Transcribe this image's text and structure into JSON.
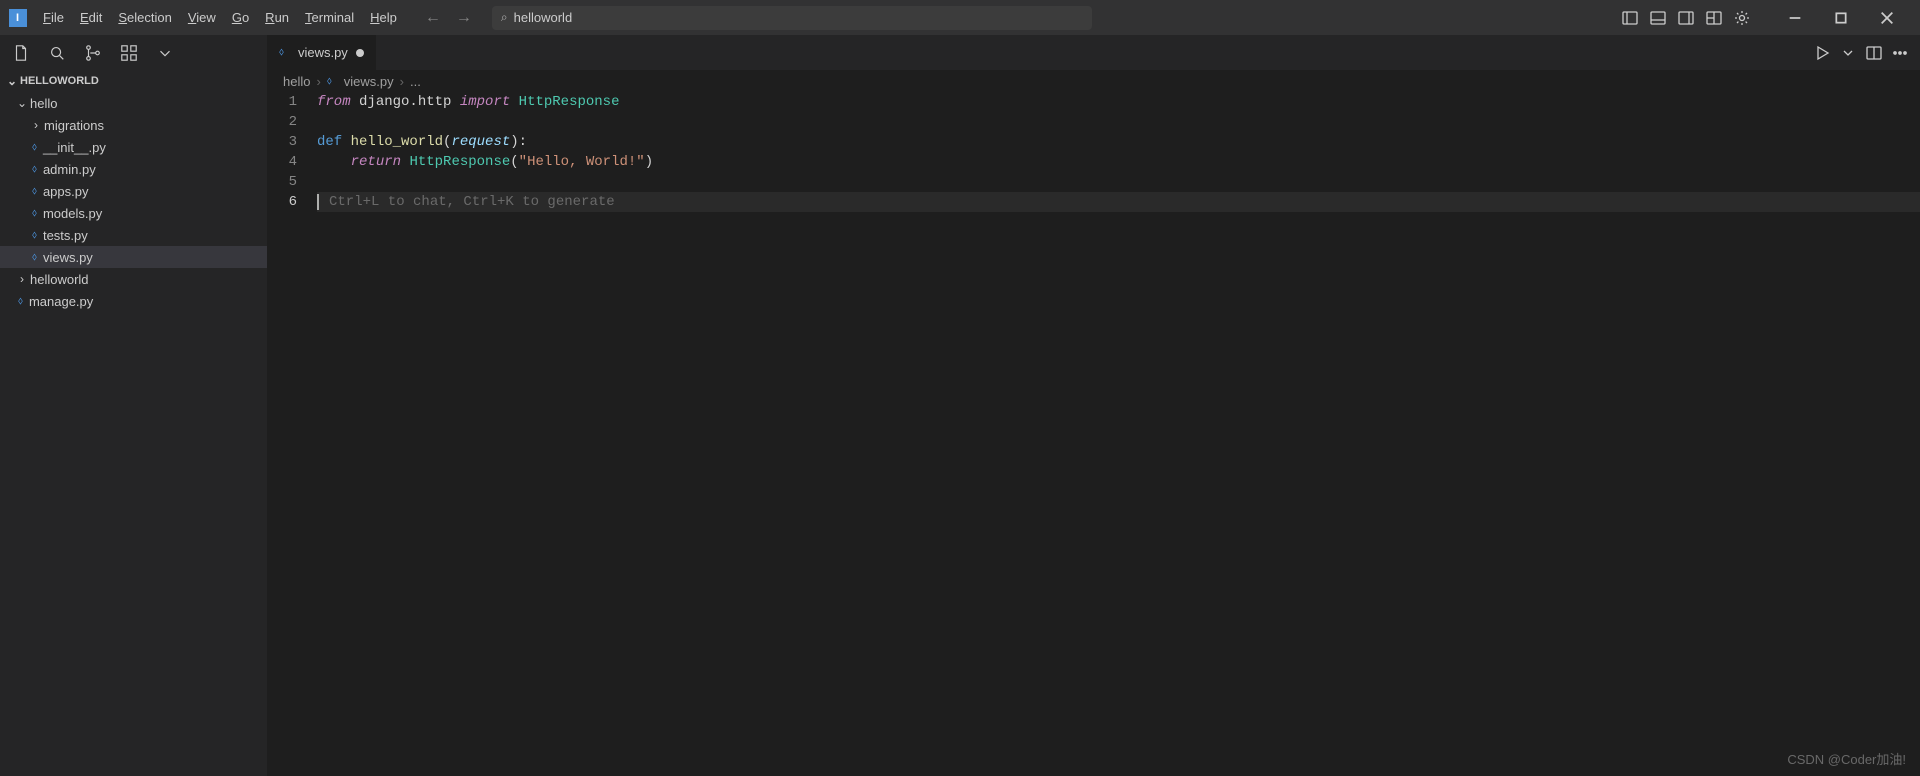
{
  "titlebar": {
    "menus": [
      "File",
      "Edit",
      "Selection",
      "View",
      "Go",
      "Run",
      "Terminal",
      "Help"
    ],
    "search_text": "helloworld"
  },
  "sidebar": {
    "project_name": "HELLOWORLD",
    "tree": {
      "hello": {
        "label": "hello",
        "children": [
          {
            "label": "migrations",
            "type": "folder"
          },
          {
            "label": "__init__.py",
            "type": "py"
          },
          {
            "label": "admin.py",
            "type": "py"
          },
          {
            "label": "apps.py",
            "type": "py"
          },
          {
            "label": "models.py",
            "type": "py"
          },
          {
            "label": "tests.py",
            "type": "py"
          },
          {
            "label": "views.py",
            "type": "py",
            "active": true
          }
        ]
      },
      "helloworld": {
        "label": "helloworld",
        "type": "folder"
      },
      "manage": {
        "label": "manage.py",
        "type": "py"
      }
    }
  },
  "tabs": {
    "active": {
      "label": "views.py",
      "modified": true
    }
  },
  "breadcrumb": {
    "parts": [
      "hello",
      "views.py",
      "..."
    ]
  },
  "code": {
    "line1": {
      "from": "from",
      "mod": "django.http",
      "import": "import",
      "cls": "HttpResponse"
    },
    "line3": {
      "def": "def",
      "fn": "hello_world",
      "param": "request"
    },
    "line4": {
      "return": "return",
      "cls": "HttpResponse",
      "str": "\"Hello, World!\""
    },
    "hint": "Ctrl+L to chat, Ctrl+K to generate"
  },
  "watermark": "CSDN @Coder加油!"
}
